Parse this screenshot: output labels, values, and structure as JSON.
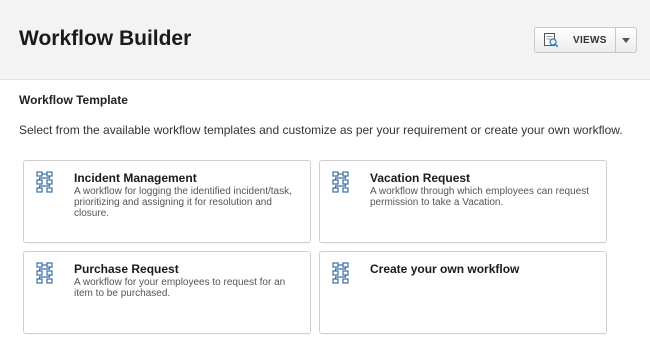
{
  "header": {
    "title": "Workflow Builder",
    "views_label": "VIEWS",
    "views_icon": "views-search-icon",
    "dropdown_icon": "caret-down-icon",
    "background": "#f3f3f3"
  },
  "section": {
    "title": "Workflow Template",
    "intro": "Select from the available workflow templates and customize as per your requirement or create your own workflow."
  },
  "templates": [
    {
      "title": "Incident Management",
      "description": "A workflow for logging the identified incident/task, prioritizing and assigning it for resolution and closure.",
      "icon": "workflow-icon"
    },
    {
      "title": "Vacation Request",
      "description": "A workflow through which employees can request permission to take a Vacation.",
      "icon": "workflow-icon"
    },
    {
      "title": "Purchase Request",
      "description": "A workflow for your employees to request for an item to be purchased.",
      "icon": "workflow-icon"
    },
    {
      "title": "Create your own workflow",
      "description": "",
      "icon": "workflow-icon"
    }
  ],
  "colors": {
    "icon_blue": "#3b6ea5",
    "card_border": "#cfcfcf"
  }
}
